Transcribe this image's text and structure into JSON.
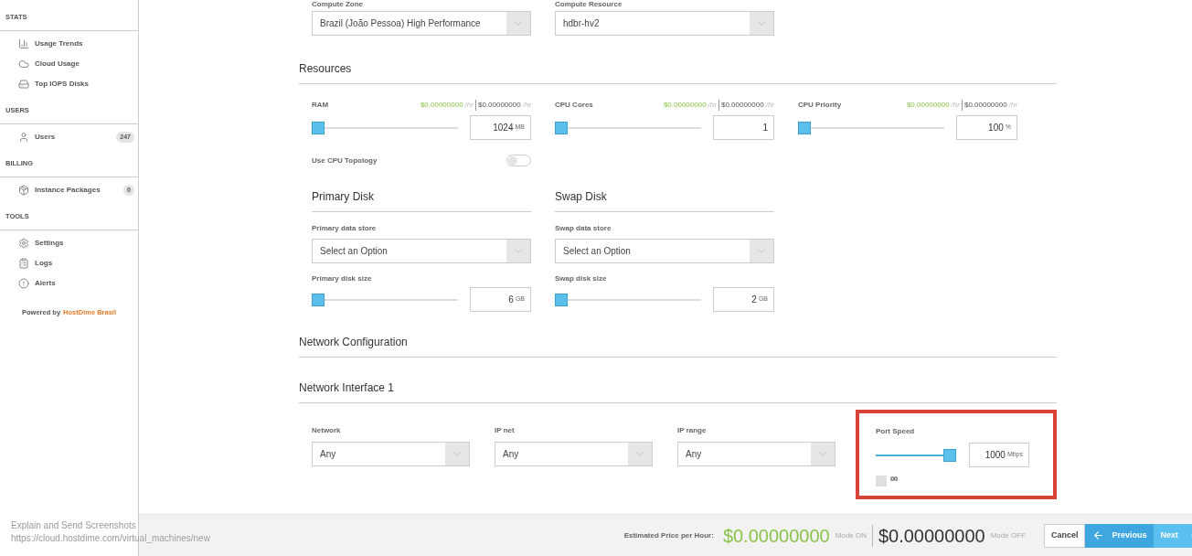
{
  "sidebar": {
    "sections": [
      {
        "title": "STATS",
        "items": [
          {
            "label": "Usage Trends"
          },
          {
            "label": "Cloud Usage"
          },
          {
            "label": "Top IOPS Disks"
          }
        ]
      },
      {
        "title": "USERS",
        "items": [
          {
            "label": "Users",
            "badge": "247"
          }
        ]
      },
      {
        "title": "BILLING",
        "items": [
          {
            "label": "Instance Packages",
            "badge": "0"
          }
        ]
      },
      {
        "title": "TOOLS",
        "items": [
          {
            "label": "Settings"
          },
          {
            "label": "Logs"
          },
          {
            "label": "Alerts"
          }
        ]
      }
    ],
    "powered_prefix": "Powered by",
    "powered_link": "HostDime Brasil"
  },
  "compute": [
    {
      "label": "Compute Zone",
      "value": "Brazil (João Pessoa) High Performance"
    },
    {
      "label": "Compute Resource",
      "value": "hdbr-hv2"
    }
  ],
  "resources": {
    "title": "Resources",
    "sliders": [
      {
        "label": "RAM",
        "price_on": "$0.00000000",
        "unit_on": "/hr",
        "price_off": "$0.00000000",
        "unit_off": "/hr",
        "level": 0,
        "value": "1024",
        "unit": "MB"
      },
      {
        "label": "CPU Cores",
        "price_on": "$0.00000000",
        "unit_on": "/hr",
        "price_off": "$0.00000000",
        "unit_off": "/hr",
        "level": 0,
        "value": "1"
      },
      {
        "label": "CPU Priority",
        "price_on": "$0.00000000",
        "unit_on": "/hr",
        "price_off": "$0.00000000",
        "unit_off": "/hr",
        "level": 0,
        "value": "100",
        "unit": "%"
      }
    ],
    "topology": {
      "label": "Use CPU Topology",
      "on": false
    }
  },
  "disks": [
    {
      "title": "Primary Disk",
      "store_label": "Primary data store",
      "store_value": "Select an Option",
      "size_label": "Primary disk size",
      "level": 0,
      "value": "6",
      "unit": "GB"
    },
    {
      "title": "Swap Disk",
      "store_label": "Swap data store",
      "store_value": "Select an Option",
      "size_label": "Swap disk size",
      "level": 0,
      "value": "2",
      "unit": "GB"
    }
  ],
  "network_config": {
    "title": "Network Configuration"
  },
  "interface": {
    "title": "Network Interface 1",
    "selects": [
      {
        "label": "Network",
        "value": "Any"
      },
      {
        "label": "IP net",
        "value": "Any"
      },
      {
        "label": "IP range",
        "value": "Any"
      }
    ],
    "port_speed": {
      "label": "Port Speed",
      "level": 1,
      "value": "1000",
      "unit": "Mbps",
      "highlighted": true,
      "unlimited": {
        "label": "∞",
        "checked": false
      }
    }
  },
  "footer": {
    "label": "Estimated Price per Hour:",
    "price_on": "$0.00000000",
    "mode_on": "Mode ON",
    "price_off": "$0.00000000",
    "mode_off": "Mode OFF",
    "buttons": [
      {
        "label": "Cancel",
        "kind": "cancel"
      },
      {
        "label": "Previous",
        "kind": "previous"
      },
      {
        "label": "Next",
        "kind": "next"
      }
    ]
  },
  "overlay": {
    "title": "Explain and Send Screenshots",
    "url": "https://cloud.hostdime.com/virtual_machines/new"
  }
}
